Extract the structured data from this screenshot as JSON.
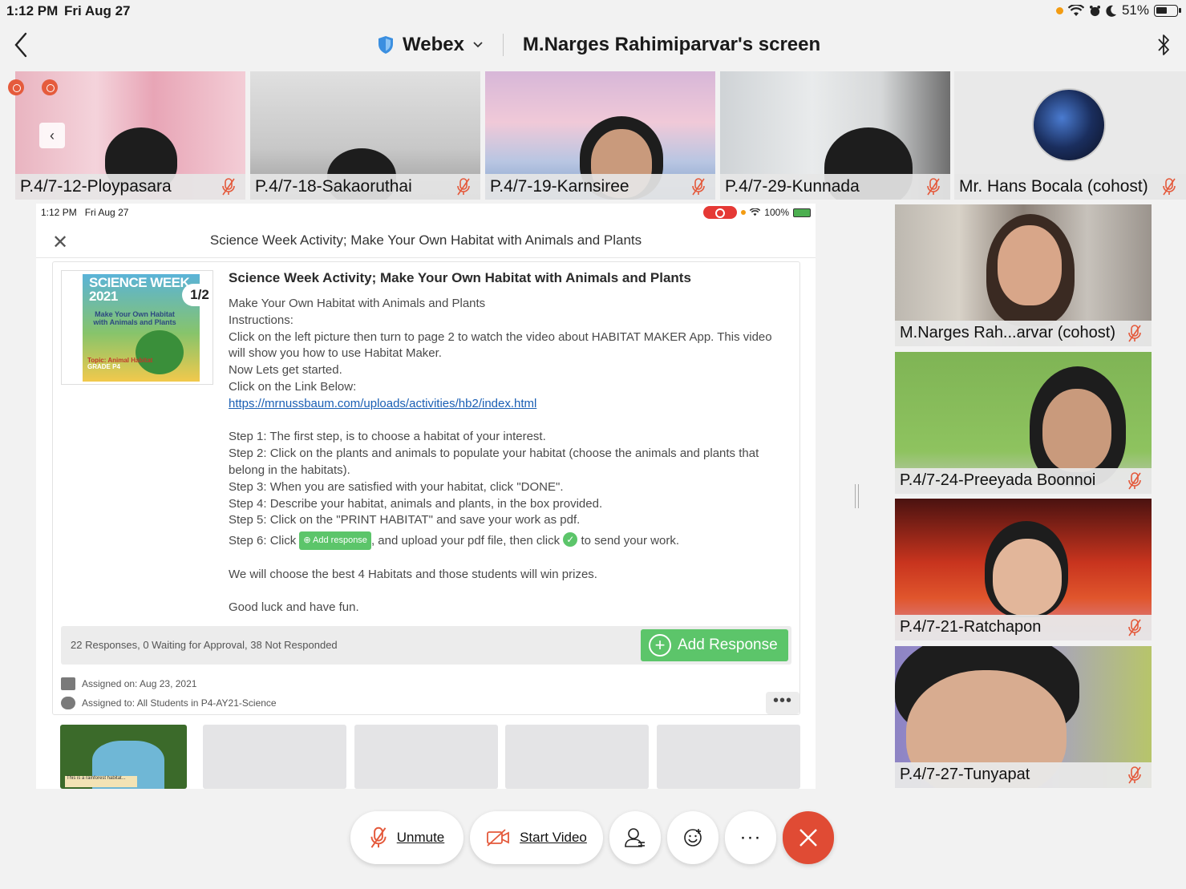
{
  "status": {
    "time": "1:12 PM",
    "date": "Fri Aug 27",
    "battery": "51%"
  },
  "nav": {
    "app": "Webex",
    "screen_title": "M.Narges Rahimiparvar's screen"
  },
  "thumbs": [
    {
      "name": "P.4/7-12-Ploypasara"
    },
    {
      "name": "P.4/7-18-Sakaoruthai"
    },
    {
      "name": "P.4/7-19-Karnsiree"
    },
    {
      "name": "P.4/7-29-Kunnada"
    },
    {
      "name": "Mr. Hans Bocala (cohost)"
    }
  ],
  "shared": {
    "time": "1:12 PM",
    "date": "Fri Aug 27",
    "battery": "100%",
    "header_title": "Science Week Activity; Make Your Own Habitat with Animals and Plants",
    "poster": {
      "title": "SCIENCE WEEK 2021",
      "subtitle": "Make Your Own Habitat with Animals and Plants",
      "topic": "Topic: Animal Habitat",
      "grade": "GRADE P4",
      "page": "1/2"
    },
    "heading": "Science Week Activity; Make Your Own Habitat with Animals and Plants",
    "lines": {
      "l1": "Make Your Own Habitat with Animals and Plants",
      "l2": "Instructions:",
      "l3": "Click on the left picture then turn to page 2 to watch the video about HABITAT MAKER App. This video will show you how to use Habitat Maker.",
      "l4": "Now Lets get started.",
      "l5": "Click on the Link Below:",
      "link": "https://mrnussbaum.com/uploads/activities/hb2/index.html",
      "s1": "Step 1: The first step, is to choose a habitat of your interest.",
      "s2": "Step 2: Click on the plants and animals to populate your habitat (choose the animals and plants that belong in the habitats).",
      "s3": "Step 3: When you are satisfied with your habitat, click \"DONE\".",
      "s4": "Step 4: Describe your habitat, animals and plants, in the box provided.",
      "s5": "Step 5: Click on the \"PRINT HABITAT\" and save your work as pdf.",
      "s6a": "Step 6: Click",
      "s6b": ", and upload your pdf file, then click",
      "s6c": "to send your work.",
      "s6_button": "Add response",
      "prize": "We will choose the best 4 Habitats and those students will win prizes.",
      "luck": "Good luck and have fun."
    },
    "responses": "22 Responses, 0 Waiting for Approval, 38 Not Responded",
    "add_response": "Add Response",
    "assigned_on": "Assigned on: Aug 23, 2021",
    "assigned_to": "Assigned to: All Students in P4-AY21-Science",
    "gallery_caption": "This is a rainforest habitat..."
  },
  "side": [
    {
      "name": "M.Narges Rah...arvar (cohost)"
    },
    {
      "name": "P.4/7-24-Preeyada Boonnoi"
    },
    {
      "name": "P.4/7-21-Ratchapon"
    },
    {
      "name": "P.4/7-27-Tunyapat"
    }
  ],
  "toolbar": {
    "unmute": "Unmute",
    "start_video": "Start Video",
    "more": "···"
  },
  "colors": {
    "accent_green": "#5cc56a",
    "end_red": "#e04b34",
    "link_blue": "#1a5fb4"
  }
}
